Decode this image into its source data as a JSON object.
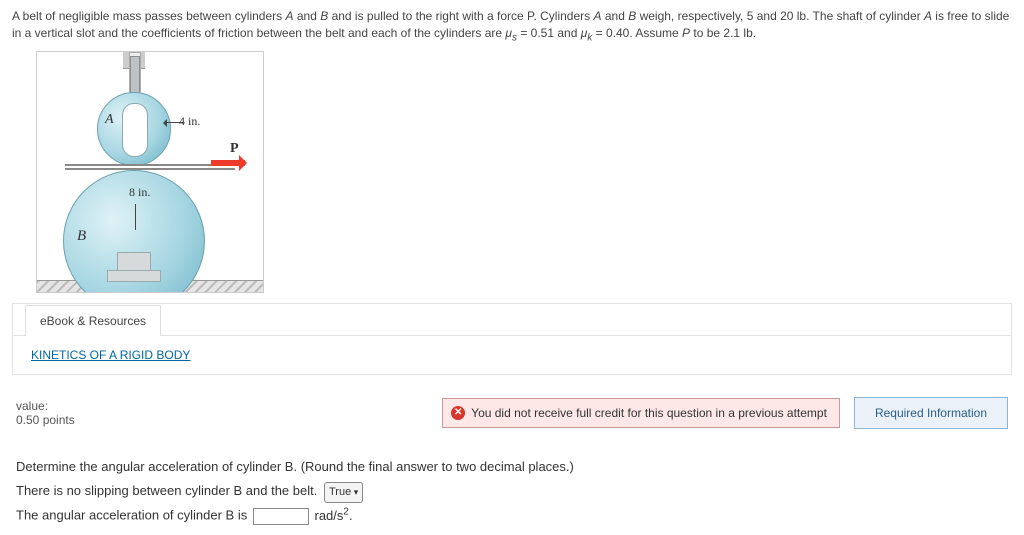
{
  "problem": {
    "text_html": "A belt of negligible mass passes between cylinders <i>A</i> and <i>B</i> and is pulled to the right with a force P. Cylinders <i>A</i> and <i>B</i> weigh, respectively, 5 and 20 lb. The shaft of cylinder <i>A</i> is free to slide in a vertical slot and the coefficients of friction between the belt and each of the cylinders are <i>μ<sub>s</sub></i> = 0.51 and <i>μ<sub>k</sub></i> = 0.40. Assume <i>P</i> to be 2.1 lb."
  },
  "diagram": {
    "labelA": "A",
    "dimA": "4 in.",
    "labelP": "P",
    "labelB": "B",
    "dimB": "8 in."
  },
  "resources": {
    "tab": "eBook & Resources",
    "link": "KINETICS OF A RIGID BODY"
  },
  "value": {
    "label": "value:",
    "points": "0.50 points"
  },
  "alert": {
    "text": "You did not receive full credit for this question in a previous attempt"
  },
  "required": {
    "label": "Required Information"
  },
  "question": {
    "prompt": "Determine the angular acceleration of cylinder B. (Round the final answer to two decimal places.)",
    "line1_pre": "There is no slipping between cylinder B and the belt.",
    "tf_value": "True",
    "line2_pre": "The angular acceleration of cylinder B is",
    "line2_post_html": "rad/s<sup>2</sup>."
  }
}
